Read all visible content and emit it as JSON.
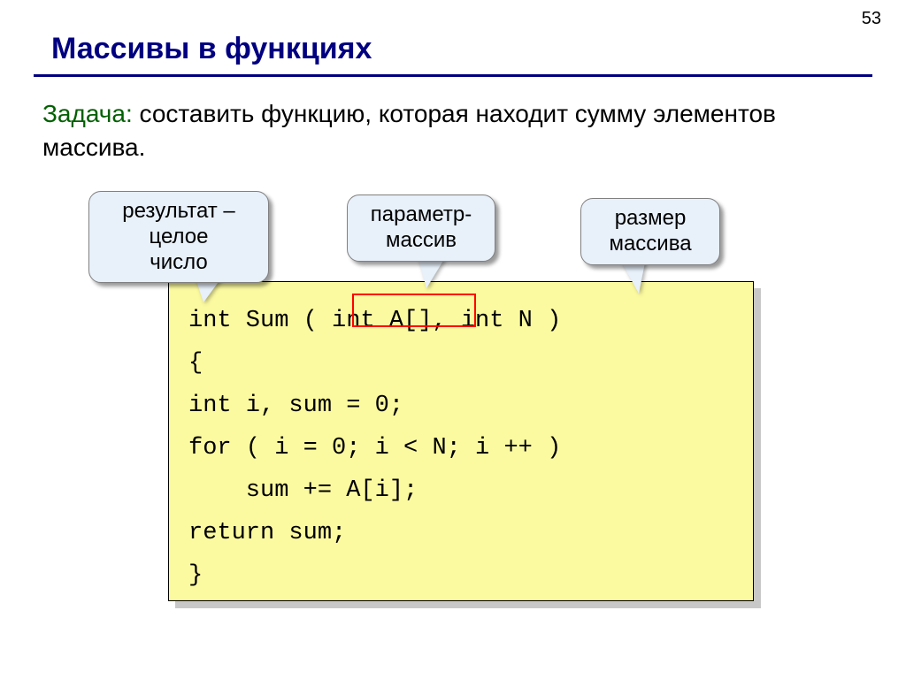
{
  "page_number": "53",
  "title": "Массивы в функциях",
  "task": {
    "label": "Задача:",
    "text": " составить функцию, которая находит сумму элементов массива."
  },
  "callouts": {
    "c1_line1": "результат –",
    "c1_line2": "целое",
    "c1_line3": "число",
    "c2_line1": "параметр-",
    "c2_line2": "массив",
    "c3_line1": "размер",
    "c3_line2": "массива"
  },
  "code": {
    "l1": "int Sum ( int A[], int N )",
    "l2": "{",
    "l3": "int i, sum = 0;",
    "l4": "for ( i = 0; i < N; i ++ )",
    "l5": "    sum += A[i];",
    "l6": "return sum;",
    "l7": "}"
  }
}
